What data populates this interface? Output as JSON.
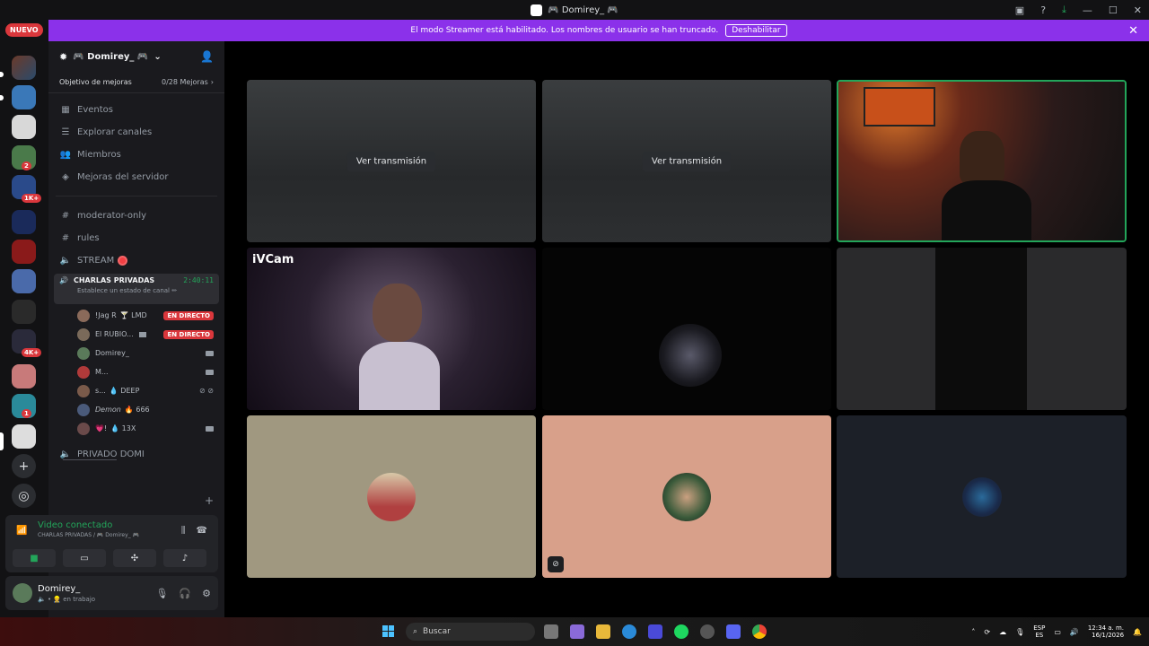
{
  "window": {
    "title": "🎮 Domirey_ 🎮"
  },
  "banner": {
    "message": "El modo Streamer está habilitado. Los nombres de usuario se han truncado.",
    "disable_label": "Deshabilitar"
  },
  "servers": {
    "new_label": "NUEVO",
    "badges": [
      "2",
      "1K+",
      "4K+",
      "1"
    ]
  },
  "guild": {
    "name": "🎮 Domirey_ 🎮",
    "boost_label": "Objetivo de mejoras",
    "boost_count": "0/28 Mejoras"
  },
  "nav": [
    {
      "label": "Eventos",
      "icon": "calendar-icon"
    },
    {
      "label": "Explorar canales",
      "icon": "channels-icon"
    },
    {
      "label": "Miembros",
      "icon": "members-icon"
    },
    {
      "label": "Mejoras del servidor",
      "icon": "boost-icon"
    }
  ],
  "channels": [
    {
      "name": "moderator-only",
      "type": "text"
    },
    {
      "name": "rules",
      "type": "text"
    },
    {
      "name": "STREAM",
      "type": "voice"
    }
  ],
  "active_voice": {
    "name": "CHARLAS PRIVADAS",
    "timer": "2:40:11",
    "status_hint": "Establece un estado de canal ✏"
  },
  "members": [
    {
      "name": "!Jag R",
      "tag": "🍸 LMD",
      "live_label": "EN DIRECTO",
      "color": "#8a6a5a"
    },
    {
      "name": "El RUBIO...",
      "tag": "",
      "live_label": "EN DIRECTO",
      "color": "#7a6a5a"
    },
    {
      "name": "Domirey_",
      "tag": "",
      "live_label": "",
      "color": "#5a7a5a"
    },
    {
      "name": "M...",
      "tag": "",
      "live_label": "",
      "color": "#b03a3a"
    },
    {
      "name": "s...",
      "tag": "💧 DEEP",
      "live_label": "",
      "color": "#7a5a4a"
    },
    {
      "name": "Demon",
      "tag": "🔥 666",
      "live_label": "",
      "color": "#4a5a7a"
    },
    {
      "name": "💗!",
      "tag": "💧 13X",
      "live_label": "",
      "color": "#6a4a4a"
    }
  ],
  "other_channel": {
    "name": "PRIVADO DOMI"
  },
  "voice_panel": {
    "title": "Video conectado",
    "subtitle": "CHARLAS PRIVADAS / 🎮 Domirey_ 🎮"
  },
  "user": {
    "name": "Domirey_",
    "status": "🔈 • 👷 en trabajo"
  },
  "tiles": {
    "watch_label": "Ver transmisión",
    "ivcam_label": "iVCam"
  },
  "taskbar": {
    "search_placeholder": "Buscar",
    "lang_top": "ESP",
    "lang_bottom": "ES",
    "time": "12:34 a. m.",
    "date": "16/1/2026"
  }
}
